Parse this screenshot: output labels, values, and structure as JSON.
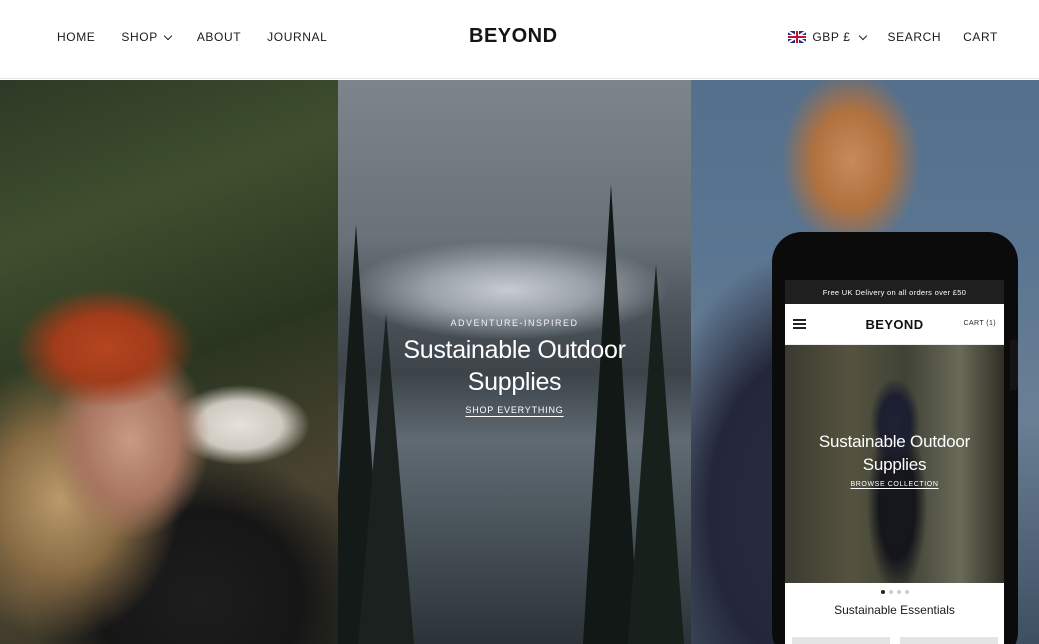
{
  "header": {
    "nav_left": [
      "HOME",
      "SHOP",
      "ABOUT",
      "JOURNAL"
    ],
    "logo": "BEYOND",
    "currency": "GBP £",
    "search": "SEARCH",
    "cart": "CART"
  },
  "hero": {
    "kicker": "ADVENTURE-INSPIRED",
    "title_line1": "Sustainable Outdoor",
    "title_line2": "Supplies",
    "cta": "SHOP EVERYTHING"
  },
  "mobile": {
    "promo": "Free UK Delivery on all orders over £50",
    "logo": "BEYOND",
    "cart": "CART (1)",
    "hero_title_line1": "Sustainable Outdoor",
    "hero_title_line2": "Supplies",
    "hero_cta": "BROWSE COLLECTION",
    "section_title": "Sustainable Essentials",
    "slide_count": 4,
    "active_slide": 1
  },
  "icons": {
    "shop_dropdown": "chevron-down-icon",
    "currency_flag": "uk-flag-icon",
    "currency_dropdown": "chevron-down-icon",
    "mobile_menu": "hamburger-menu-icon"
  }
}
